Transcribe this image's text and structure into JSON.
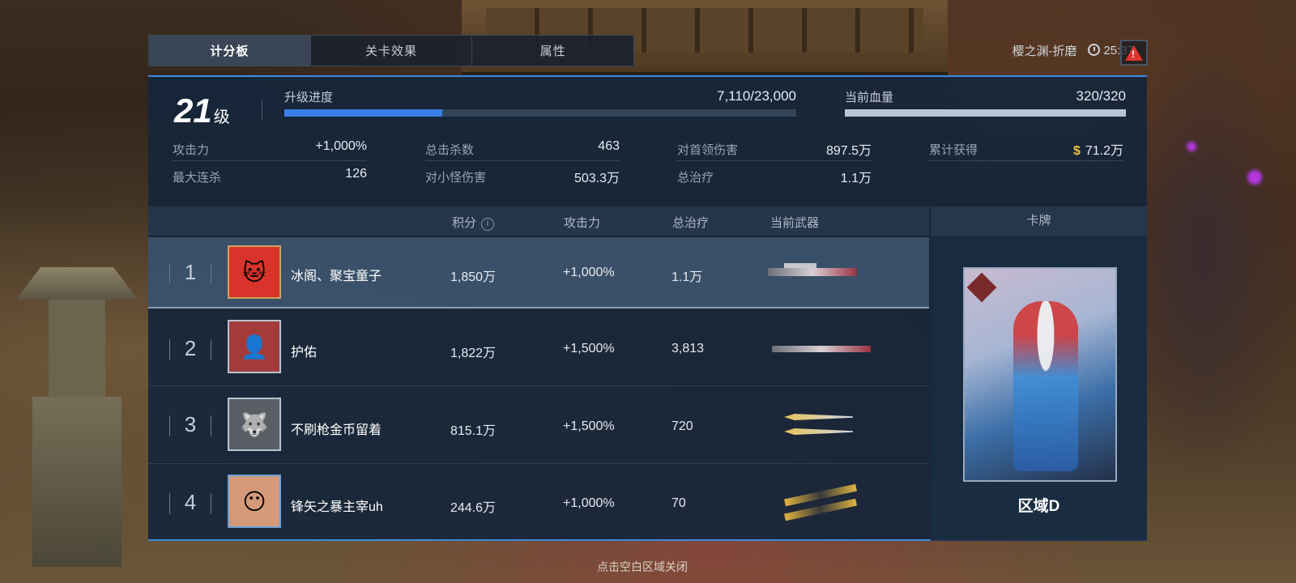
{
  "tabs": [
    {
      "label": "计分板",
      "active": true
    },
    {
      "label": "关卡效果",
      "active": false
    },
    {
      "label": "属性",
      "active": false
    }
  ],
  "header": {
    "stage": "樱之渊-折磨",
    "timer": "25:37"
  },
  "level": {
    "number": "21",
    "unit": "级"
  },
  "progress": {
    "label": "升级进度",
    "value_text": "7,110/23,000",
    "fraction": 0.309
  },
  "health": {
    "label": "当前血量",
    "value_text": "320/320",
    "fraction": 1.0
  },
  "stats": [
    {
      "k": "攻击力",
      "v": "+1,000%"
    },
    {
      "k": "总击杀数",
      "v": "463"
    },
    {
      "k": "对首领伤害",
      "v": "897.5万"
    },
    {
      "k": "累计获得",
      "v": "71.2万",
      "currency": "$"
    },
    {
      "k": "最大连杀",
      "v": "126"
    },
    {
      "k": "对小怪伤害",
      "v": "503.3万"
    },
    {
      "k": "总治疗",
      "v": "1.1万"
    }
  ],
  "table": {
    "headers": {
      "score": "积分",
      "attack": "攻击力",
      "heal": "总治疗",
      "weapon": "当前武器",
      "card": "卡牌"
    },
    "rows": [
      {
        "rank": "1",
        "name": "冰阁、聚宝童子",
        "score": "1,850万",
        "attack": "+1,000%",
        "heal": "1.1万",
        "weapon_icon": "rifle-icon"
      },
      {
        "rank": "2",
        "name": "护佑",
        "score": "1,822万",
        "attack": "+1,500%",
        "heal": "3,813",
        "weapon_icon": "sniper-icon"
      },
      {
        "rank": "3",
        "name": "不刷枪金币留着",
        "score": "815.1万",
        "attack": "+1,500%",
        "heal": "720",
        "weapon_icon": "daggers-icon"
      },
      {
        "rank": "4",
        "name": "锋矢之暴主宰uh",
        "score": "244.6万",
        "attack": "+1,000%",
        "heal": "70",
        "weapon_icon": "gold-rifles-icon"
      }
    ]
  },
  "card": {
    "name": "区域D"
  },
  "footer": {
    "hint": "点击空白区域关闭"
  },
  "colors": {
    "accent": "#3b7fe6",
    "gold": "#f0c233",
    "warn": "#e0342c"
  }
}
